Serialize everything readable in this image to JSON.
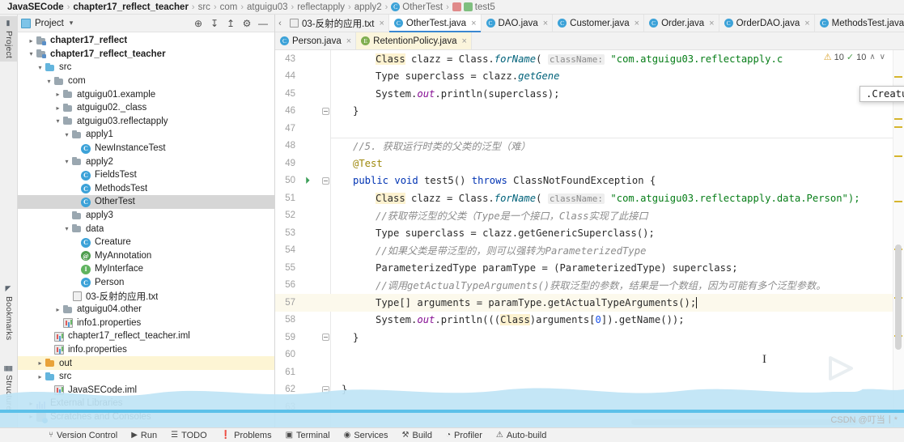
{
  "breadcrumb": [
    {
      "label": "JavaSECode",
      "bold": true,
      "icon": "none"
    },
    {
      "label": "chapter17_reflect_teacher",
      "bold": true,
      "icon": "none"
    },
    {
      "label": "src",
      "bold": false,
      "icon": "none"
    },
    {
      "label": "com",
      "bold": false,
      "icon": "none"
    },
    {
      "label": "atguigu03",
      "bold": false,
      "icon": "none"
    },
    {
      "label": "reflectapply",
      "bold": false,
      "icon": "none"
    },
    {
      "label": "apply2",
      "bold": false,
      "icon": "none"
    },
    {
      "label": "OtherTest",
      "bold": false,
      "icon": "class-icon"
    },
    {
      "label": "test5",
      "bold": false,
      "icon": "method-test-icon"
    }
  ],
  "left_strip": {
    "tabs": [
      {
        "label": "Project",
        "icon": "project-icon",
        "selected": true
      },
      {
        "label": "Bookmarks",
        "icon": "bookmark-icon",
        "selected": false
      },
      {
        "label": "Structure",
        "icon": "structure-icon",
        "selected": false
      }
    ]
  },
  "project_panel": {
    "title": "Project",
    "caret": "▾",
    "buttons": [
      {
        "name": "locate-icon",
        "glyph": "⊕"
      },
      {
        "name": "expand-all-icon",
        "glyph": "↧"
      },
      {
        "name": "collapse-all-icon",
        "glyph": "↥"
      },
      {
        "name": "settings-gear-icon",
        "glyph": "⚙"
      },
      {
        "name": "minimize-icon",
        "glyph": "—"
      }
    ],
    "tree": [
      {
        "label": "chapter17_reflect",
        "indent": 1,
        "arrow": "›",
        "icon": "module-folder",
        "bold": true,
        "state": "none"
      },
      {
        "label": "chapter17_reflect_teacher",
        "indent": 1,
        "arrow": "⌄",
        "icon": "module-folder",
        "bold": true,
        "state": "none"
      },
      {
        "label": "src",
        "indent": 2,
        "arrow": "⌄",
        "icon": "source-folder",
        "bold": false,
        "state": "none"
      },
      {
        "label": "com",
        "indent": 3,
        "arrow": "⌄",
        "icon": "package-folder",
        "bold": false,
        "state": "none"
      },
      {
        "label": "atguigu01.example",
        "indent": 4,
        "arrow": "›",
        "icon": "package-folder",
        "bold": false,
        "state": "none"
      },
      {
        "label": "atguigu02._class",
        "indent": 4,
        "arrow": "›",
        "icon": "package-folder",
        "bold": false,
        "state": "none"
      },
      {
        "label": "atguigu03.reflectapply",
        "indent": 4,
        "arrow": "⌄",
        "icon": "package-folder",
        "bold": false,
        "state": "none"
      },
      {
        "label": "apply1",
        "indent": 5,
        "arrow": "⌄",
        "icon": "package-folder",
        "bold": false,
        "state": "none"
      },
      {
        "label": "NewInstanceTest",
        "indent": 6,
        "arrow": "",
        "icon": "class-icon",
        "bold": false,
        "state": "none"
      },
      {
        "label": "apply2",
        "indent": 5,
        "arrow": "⌄",
        "icon": "package-folder",
        "bold": false,
        "state": "none"
      },
      {
        "label": "FieldsTest",
        "indent": 6,
        "arrow": "",
        "icon": "class-icon",
        "bold": false,
        "state": "none"
      },
      {
        "label": "MethodsTest",
        "indent": 6,
        "arrow": "",
        "icon": "class-icon",
        "bold": false,
        "state": "none"
      },
      {
        "label": "OtherTest",
        "indent": 6,
        "arrow": "",
        "icon": "class-icon",
        "bold": false,
        "state": "selected"
      },
      {
        "label": "apply3",
        "indent": 5,
        "arrow": "",
        "icon": "package-folder",
        "bold": false,
        "state": "none"
      },
      {
        "label": "data",
        "indent": 5,
        "arrow": "⌄",
        "icon": "package-folder",
        "bold": false,
        "state": "none"
      },
      {
        "label": "Creature",
        "indent": 6,
        "arrow": "",
        "icon": "class-icon",
        "bold": false,
        "state": "none"
      },
      {
        "label": "MyAnnotation",
        "indent": 6,
        "arrow": "",
        "icon": "annotation-icon",
        "bold": false,
        "state": "none"
      },
      {
        "label": "MyInterface",
        "indent": 6,
        "arrow": "",
        "icon": "interface-icon",
        "bold": false,
        "state": "none"
      },
      {
        "label": "Person",
        "indent": 6,
        "arrow": "",
        "icon": "class-icon",
        "bold": false,
        "state": "none"
      },
      {
        "label": "03-反射的应用.txt",
        "indent": 5,
        "arrow": "",
        "icon": "text-file-icon",
        "bold": false,
        "state": "none"
      },
      {
        "label": "atguigu04.other",
        "indent": 4,
        "arrow": "›",
        "icon": "package-folder",
        "bold": false,
        "state": "none"
      },
      {
        "label": "info1.properties",
        "indent": 4,
        "arrow": "",
        "icon": "properties-icon",
        "bold": false,
        "state": "none"
      },
      {
        "label": "chapter17_reflect_teacher.iml",
        "indent": 3,
        "arrow": "",
        "icon": "iml-icon",
        "bold": false,
        "state": "none"
      },
      {
        "label": "info.properties",
        "indent": 3,
        "arrow": "",
        "icon": "properties-icon",
        "bold": false,
        "state": "none"
      },
      {
        "label": "out",
        "indent": 2,
        "arrow": "›",
        "icon": "out-folder",
        "bold": false,
        "state": "highlight"
      },
      {
        "label": "src",
        "indent": 2,
        "arrow": "›",
        "icon": "source-folder",
        "bold": false,
        "state": "none"
      },
      {
        "label": "JavaSECode.iml",
        "indent": 3,
        "arrow": "",
        "icon": "iml-icon",
        "bold": false,
        "state": "none"
      },
      {
        "label": "External Libraries",
        "indent": 1,
        "arrow": "›",
        "icon": "library-icon",
        "bold": false,
        "state": "none"
      },
      {
        "label": "Scratches and Consoles",
        "indent": 1,
        "arrow": "›",
        "icon": "scratches-icon",
        "bold": false,
        "state": "none"
      }
    ]
  },
  "editor": {
    "tabs_row1": [
      {
        "label": "03-反射的应用.txt",
        "icon": "text-file-icon",
        "state": "normal"
      },
      {
        "label": "OtherTest.java",
        "icon": "class-icon",
        "state": "active"
      },
      {
        "label": "DAO.java",
        "icon": "class-icon",
        "state": "normal"
      },
      {
        "label": "Customer.java",
        "icon": "class-icon",
        "state": "normal"
      },
      {
        "label": "Order.java",
        "icon": "class-icon",
        "state": "normal"
      },
      {
        "label": "OrderDAO.java",
        "icon": "class-icon",
        "state": "normal"
      },
      {
        "label": "MethodsTest.java",
        "icon": "class-icon",
        "state": "normal"
      }
    ],
    "tabs_row2": [
      {
        "label": "Person.java",
        "icon": "class-icon",
        "state": "normal"
      },
      {
        "label": "RetentionPolicy.java",
        "icon": "enum-icon",
        "state": "yellow"
      }
    ],
    "tab_overflow_glyph": "⋮",
    "close_glyph": "×",
    "inspections": {
      "warning_count": "10",
      "ok_count": "10",
      "up_glyph": "∧",
      "down_glyph": "∨"
    },
    "type_popup": ".Creature<java.lang.String>",
    "lines": [
      {
        "n": "43",
        "fold": false,
        "run": false,
        "current": false
      },
      {
        "n": "44",
        "fold": false,
        "run": false,
        "current": false
      },
      {
        "n": "45",
        "fold": false,
        "run": false,
        "current": false
      },
      {
        "n": "46",
        "fold": true,
        "run": false,
        "current": false
      },
      {
        "n": "47",
        "fold": false,
        "run": false,
        "current": false
      },
      {
        "n": "48",
        "fold": false,
        "run": false,
        "current": false
      },
      {
        "n": "49",
        "fold": false,
        "run": false,
        "current": false
      },
      {
        "n": "50",
        "fold": true,
        "run": true,
        "current": false
      },
      {
        "n": "51",
        "fold": false,
        "run": false,
        "current": false
      },
      {
        "n": "52",
        "fold": false,
        "run": false,
        "current": false
      },
      {
        "n": "53",
        "fold": false,
        "run": false,
        "current": false
      },
      {
        "n": "54",
        "fold": false,
        "run": false,
        "current": false
      },
      {
        "n": "55",
        "fold": false,
        "run": false,
        "current": false
      },
      {
        "n": "56",
        "fold": false,
        "run": false,
        "current": false
      },
      {
        "n": "57",
        "fold": false,
        "run": false,
        "current": true
      },
      {
        "n": "58",
        "fold": false,
        "run": false,
        "current": false
      },
      {
        "n": "59",
        "fold": true,
        "run": false,
        "current": false
      },
      {
        "n": "60",
        "fold": false,
        "run": false,
        "current": false
      },
      {
        "n": "61",
        "fold": false,
        "run": false,
        "current": false
      },
      {
        "n": "62",
        "fold": true,
        "run": false,
        "current": false
      },
      {
        "n": "63",
        "fold": false,
        "run": false,
        "current": false
      }
    ],
    "code_text": {
      "l43": "Class clazz = Class.forName( className: \"com.atguigu03.reflectapply.c",
      "l44": "Type superclass = clazz.getGene",
      "l45": "System.out.println(superclass);",
      "l46": "}",
      "l48": "//5. 获取运行时类的父类的泛型（难）",
      "l49": "@Test",
      "l50": "public void test5() throws ClassNotFoundException {",
      "l51": "Class clazz = Class.forName( className: \"com.atguigu03.reflectapply.data.Person\");",
      "l52": "//获取带泛型的父类（Type是一个接口，Class实现了此接口",
      "l53": "Type superclass = clazz.getGenericSuperclass();",
      "l54": "//如果父类是带泛型的，则可以强转为ParameterizedType",
      "l55": "ParameterizedType paramType = (ParameterizedType) superclass;",
      "l56": "//调用getActualTypeArguments()获取泛型的参数，结果是一个数组，因为可能有多个泛型参数。",
      "l57": "Type[] arguments = paramType.getActualTypeArguments();",
      "l58": "System.out.println(((Class)arguments[0]).getName());",
      "l59": "}",
      "l62": "}"
    }
  },
  "status_bar": [
    {
      "label": "Version Control",
      "icon": "branch-icon",
      "glyph": "⑂"
    },
    {
      "label": "Run",
      "icon": "run-icon",
      "glyph": "▶"
    },
    {
      "label": "TODO",
      "icon": "todo-icon",
      "glyph": "☰"
    },
    {
      "label": "Problems",
      "icon": "problems-icon",
      "glyph": "❗"
    },
    {
      "label": "Terminal",
      "icon": "terminal-icon",
      "glyph": "▣"
    },
    {
      "label": "Services",
      "icon": "services-icon",
      "glyph": "◉"
    },
    {
      "label": "Build",
      "icon": "build-icon",
      "glyph": "⚒"
    },
    {
      "label": "Profiler",
      "icon": "profiler-icon",
      "glyph": "◔"
    },
    {
      "label": "Auto-build",
      "icon": "autobuild-icon",
      "glyph": "⚠"
    }
  ],
  "watermark": {
    "csdn": "CSDN @叮当丨*"
  },
  "colors": {
    "accent": "#3a87d0",
    "keyword": "#0033b3",
    "string": "#067d17",
    "comment": "#8c8c8c",
    "annotation": "#9e880d",
    "warning": "#d9a22b",
    "wave": "#bfe4f5"
  }
}
